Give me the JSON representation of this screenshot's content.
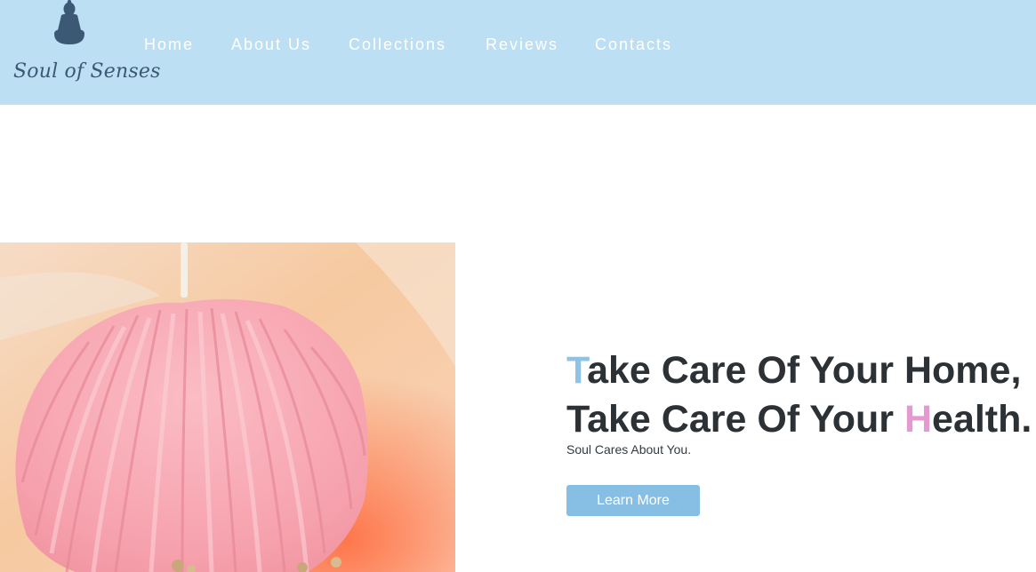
{
  "brand": {
    "name": "Soul of Senses",
    "logo_icon": "buddha-icon"
  },
  "nav": {
    "items": [
      "Home",
      "About Us",
      "Collections",
      "Reviews",
      "Contacts"
    ]
  },
  "hero": {
    "line1_initial": "T",
    "line1_rest": "ake Care Of Your Home,",
    "line2_pre": "Take Care Of Your ",
    "line2_initial": "H",
    "line2_rest": "ealth.",
    "subtitle": "Soul Cares About You.",
    "button_label": "Learn More",
    "image": "pink-seashell-candle-image"
  },
  "colors": {
    "header_bg": "#bddff3",
    "accent_blue": "#8fc3e4",
    "accent_pink": "#e49ad0",
    "button_bg": "#86bfe3",
    "logo_color": "#3b5874"
  }
}
